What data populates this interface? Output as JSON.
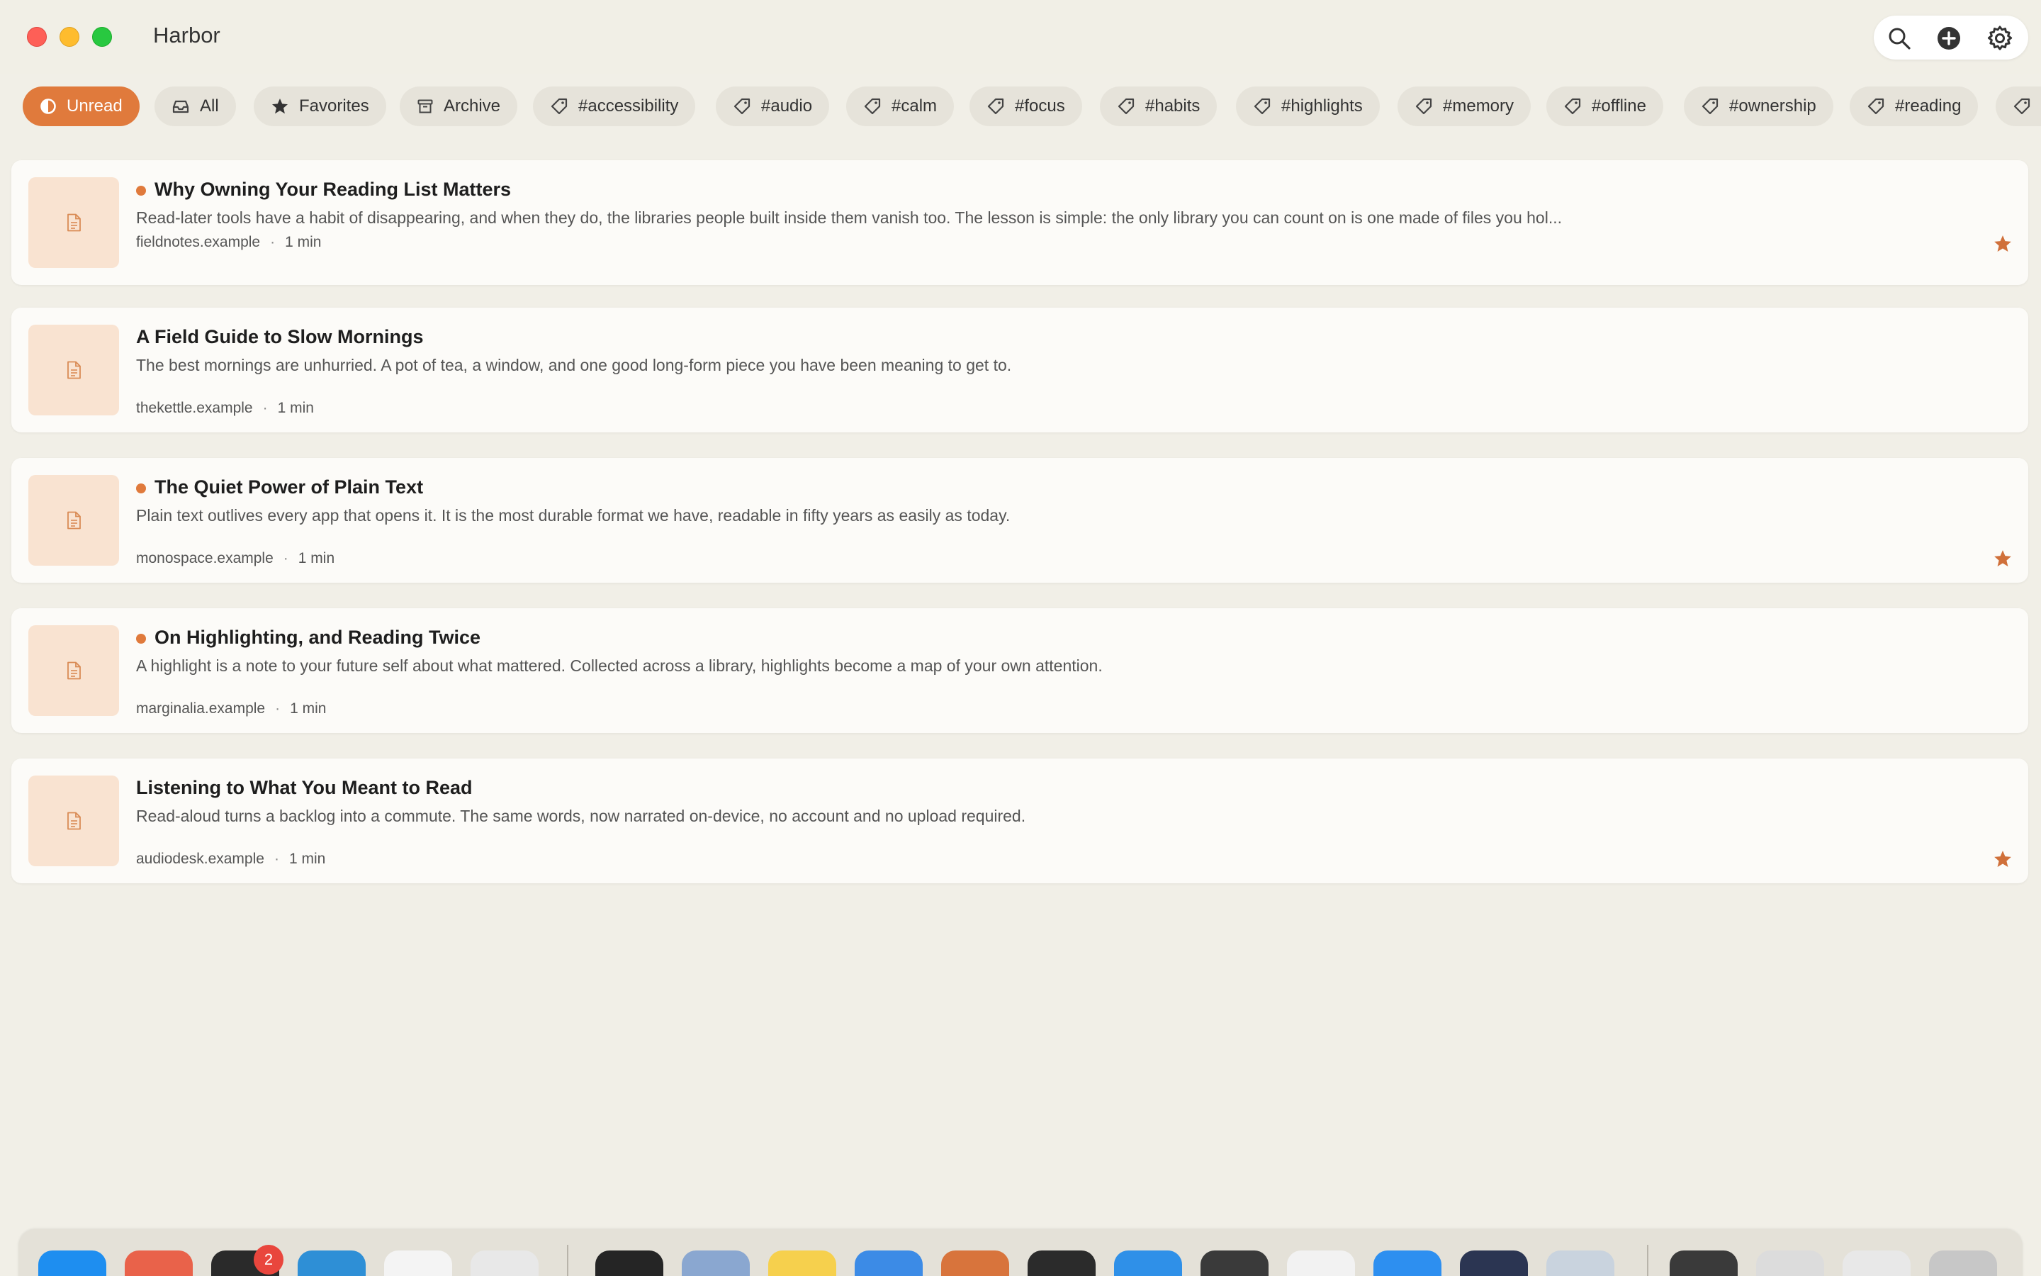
{
  "window": {
    "title": "Harbor",
    "toolbar": {
      "search_icon": "magnifying-glass",
      "add_icon": "plus-circle",
      "settings_icon": "gear"
    }
  },
  "filters": [
    {
      "label": "Unread",
      "icon": "half-circle",
      "active": true
    },
    {
      "label": "All",
      "icon": "tray",
      "active": false
    },
    {
      "label": "Favorites",
      "icon": "star",
      "active": false
    },
    {
      "label": "Archive",
      "icon": "archive-box",
      "active": false
    },
    {
      "label": "#accessibility",
      "icon": "tag",
      "active": false
    },
    {
      "label": "#audio",
      "icon": "tag",
      "active": false
    },
    {
      "label": "#calm",
      "icon": "tag",
      "active": false
    },
    {
      "label": "#focus",
      "icon": "tag",
      "active": false
    },
    {
      "label": "#habits",
      "icon": "tag",
      "active": false
    },
    {
      "label": "#highlights",
      "icon": "tag",
      "active": false
    },
    {
      "label": "#memory",
      "icon": "tag",
      "active": false
    },
    {
      "label": "#offline",
      "icon": "tag",
      "active": false
    },
    {
      "label": "#ownership",
      "icon": "tag",
      "active": false
    },
    {
      "label": "#reading",
      "icon": "tag",
      "active": false
    }
  ],
  "articles": [
    {
      "title": "Why Owning Your Reading List Matters",
      "excerpt": "Read-later tools have a habit of disappearing, and when they do, the libraries people built inside them vanish too. The lesson is simple: the only library you can count on is one made of files you hol...",
      "source": "fieldnotes.example",
      "read_time": "1 min",
      "unread": true,
      "favorite": true
    },
    {
      "title": "A Field Guide to Slow Mornings",
      "excerpt": "The best mornings are unhurried. A pot of tea, a window, and one good long-form piece you have been meaning to get to.",
      "source": "thekettle.example",
      "read_time": "1 min",
      "unread": false,
      "favorite": false
    },
    {
      "title": "The Quiet Power of Plain Text",
      "excerpt": "Plain text outlives every app that opens it. It is the most durable format we have, readable in fifty years as easily as today.",
      "source": "monospace.example",
      "read_time": "1 min",
      "unread": true,
      "favorite": true
    },
    {
      "title": "On Highlighting, and Reading Twice",
      "excerpt": "A highlight is a note to your future self about what mattered. Collected across a library, highlights become a map of your own attention.",
      "source": "marginalia.example",
      "read_time": "1 min",
      "unread": true,
      "favorite": false
    },
    {
      "title": "Listening to What You Meant to Read",
      "excerpt": "Read-aloud turns a backlog into a commute. The same words, now narrated on-device, no account and no upload required.",
      "source": "audiodesk.example",
      "read_time": "1 min",
      "unread": false,
      "favorite": true
    }
  ],
  "dock": {
    "terminal_badge": "2"
  },
  "colors": {
    "accent": "#e07a3c",
    "background": "#f1efe7",
    "card": "#fcfbf8",
    "thumb": "#f9e3d1"
  }
}
